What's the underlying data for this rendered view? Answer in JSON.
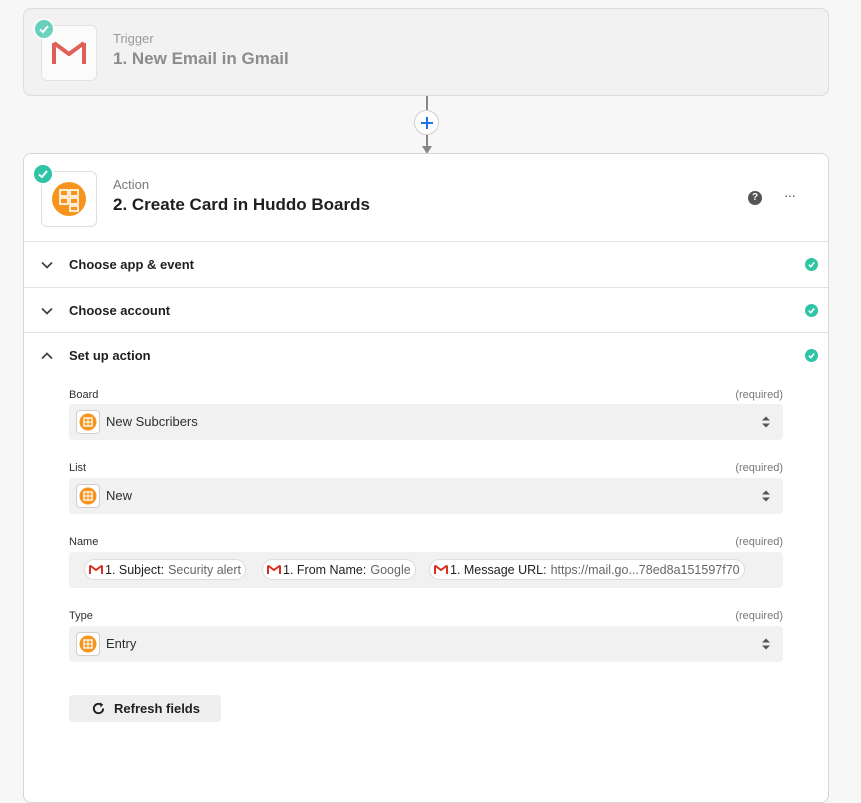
{
  "trigger": {
    "kind": "Trigger",
    "title": "1. New Email in Gmail",
    "app_icon": "gmail-icon"
  },
  "action": {
    "kind": "Action",
    "title": "2. Create Card in Huddo Boards",
    "app_icon": "huddo-boards-icon",
    "help": "?",
    "more": "···"
  },
  "sections": [
    {
      "label": "Choose app & event",
      "expanded": false,
      "complete": true
    },
    {
      "label": "Choose account",
      "expanded": false,
      "complete": true
    },
    {
      "label": "Set up action",
      "expanded": true,
      "complete": true
    }
  ],
  "fields": {
    "board": {
      "label": "Board",
      "required": "(required)",
      "value": "New Subcribers"
    },
    "list": {
      "label": "List",
      "required": "(required)",
      "value": "New"
    },
    "name": {
      "label": "Name",
      "required": "(required)",
      "pills": [
        {
          "key": "1. Subject:",
          "value": "Security alert"
        },
        {
          "key": "1. From Name:",
          "value": "Google"
        },
        {
          "key": "1. Message URL:",
          "value": "https://mail.go...78ed8a151597f70"
        }
      ]
    },
    "type": {
      "label": "Type",
      "required": "(required)",
      "value": "Entry"
    }
  },
  "refresh_label": "Refresh fields",
  "colors": {
    "accent_green": "#2fc4a6",
    "huddo_orange": "#f7941d",
    "gmail_red": "#d93025",
    "plus_blue": "#1a73e8"
  }
}
